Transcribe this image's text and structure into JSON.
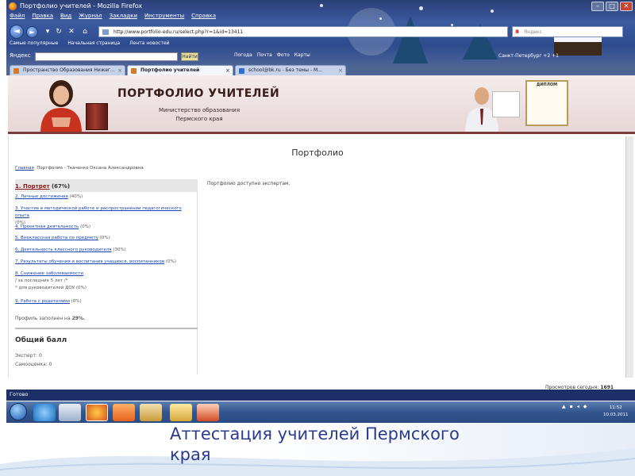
{
  "window": {
    "title": "Портфолио учителей - Mozilla Firefox",
    "minimize": "–",
    "maximize": "□",
    "close": "✕"
  },
  "menu": [
    "Файл",
    "Правка",
    "Вид",
    "Журнал",
    "Закладки",
    "Инструменты",
    "Справка"
  ],
  "nav": {
    "back": "◄",
    "forward": "►",
    "url": "http://www.portfolio-edu.ru/select.php?r=1&id=13411",
    "search_placeholder": "Яндекс",
    "search_logo": "Я"
  },
  "bookmarks": [
    "Самые популярные",
    "Начальная страница",
    "Лента новостей"
  ],
  "yandex_bar": {
    "logo": "Яндекс",
    "button": "Найти",
    "tools": [
      "Погода",
      "Почта",
      "Фото",
      "Карты"
    ],
    "weather": "Санкт-Петербург  +2  +1"
  },
  "tabs": [
    {
      "label": "Пространство Образования Нижег..."
    },
    {
      "label": "Портфолио учителей",
      "active": true
    },
    {
      "label": "school@bk.ru - Без темы - М..."
    }
  ],
  "banner": {
    "title": "ПОРТФОЛИО УЧИТЕЛЕЙ",
    "ministry": "Министерство образования",
    "region": "Пермского края",
    "diploma": "ДИПЛОМ"
  },
  "page": {
    "heading": "Портфолио",
    "breadcrumb_home": "Главная",
    "breadcrumb_current": "Портфолио - Ткаченко Оксана Александровна",
    "items": [
      {
        "link": "1. Портрет",
        "pct": "(67%)",
        "head": true
      },
      {
        "link": "2. Личные достижения",
        "pct": "(40%)"
      },
      {
        "link": "3. Участие в методической работе и распространении педагогического опыта",
        "pct": "(0%)"
      },
      {
        "link": "4. Проектная деятельность",
        "pct": "(0%)"
      },
      {
        "link": "5. Внеклассная работа по предмету",
        "pct": "(0%)"
      },
      {
        "link": "6. Деятельность классного руководителя",
        "pct": "(30%)"
      },
      {
        "link": "7. Результаты обучения и воспитания учащихся, воспитанников",
        "pct": "(0%)"
      },
      {
        "link": "8. Снижение заболеваемости",
        "pct": "/ за последние 5 лет /*",
        "note": "* для руководителей ДОУ (0%)"
      },
      {
        "link": "9. Работа с родителями",
        "pct": "(0%)"
      }
    ],
    "profile_prefix": "Профиль заполнен на",
    "profile_value": "29%.",
    "score_title": "Общий балл",
    "expert": "Эксперт: 0",
    "self": "Самооценка: 0",
    "right_message": "Портфолио доступно экспертам.",
    "views_label": "Просмотров сегодня:",
    "views_value": "1691"
  },
  "statusbar": "Готово",
  "taskbar": {
    "time": "11:52",
    "date": "10.03.2011",
    "tray": [
      "▲",
      "▪",
      "◂",
      "◆"
    ]
  },
  "caption": "Аттестация учителей Пермского края"
}
